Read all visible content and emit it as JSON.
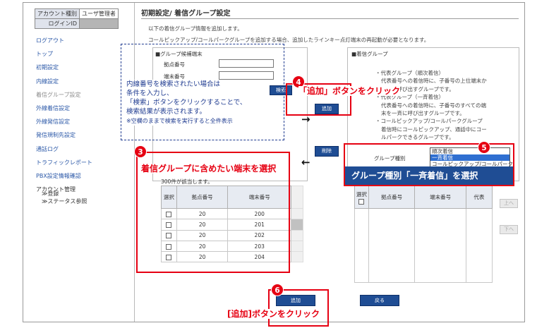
{
  "account": {
    "type_label": "アカウント種別",
    "type_value": "ユーザ管理者",
    "login_label": "ログインID"
  },
  "nav": {
    "logout": "ログアウト",
    "top": "トップ",
    "initial": "初期設定",
    "extension": "内線設定",
    "ring_group": "着信グループ設定",
    "external_in": "外線着信設定",
    "external_out": "外線発信設定",
    "call_rule": "発信規制先設定",
    "call_log": "通話ログ",
    "traffic": "トラフィックレポート",
    "pbx": "PBX設定情報確認",
    "account_mgmt": "アカウント管理",
    "register": "≫登録",
    "status": "≫ステータス参照"
  },
  "page": {
    "title": "初期設定/ 着信グループ設定",
    "desc1": "以下の着信グループ情報を追加します。",
    "desc2": "コールピックアップ/コールパークグループを追加する場合、追加したラインキー点灯端末の再起動が必要となります。"
  },
  "candidate": {
    "header": "■グループ候補端末",
    "base_label": "拠点番号",
    "ext_label": "端末番号",
    "search": "検索",
    "count": "300件が該当します。"
  },
  "buttons": {
    "add": "追加",
    "delete": "削除",
    "up": "上へ",
    "down": "下へ",
    "submit": "追加",
    "back": "戻る"
  },
  "group": {
    "header": "■着信グループ",
    "type_label": "グループ種別"
  },
  "desc_lines": [
    "・代表グループ（順次着信）",
    "代表番号への着信時に、子番号の上位端末か",
    "ら順に呼び出すグループです。",
    "・代表グループ（一斉着信）",
    "代表番号への着信時に、子番号のすべての端",
    "末を一斉に呼び出すグループです。",
    "・コールピックアップ/コールパークグループ",
    "着信時にコールピックアップ、通話中にコー",
    "ルパークできるグループです。"
  ],
  "dropdown": {
    "options": [
      "順次着信",
      "一斉着信",
      "コールピックアップ/コールパーク"
    ],
    "selected": "一斉着信"
  },
  "table": {
    "col_select": "選択",
    "col_base": "拠点番号",
    "col_ext": "端末番号",
    "col_rep": "代表",
    "rows": [
      [
        "20",
        "200"
      ],
      [
        "20",
        "201"
      ],
      [
        "20",
        "202"
      ],
      [
        "20",
        "203"
      ],
      [
        "20",
        "204"
      ]
    ]
  },
  "annotations": {
    "n3": "3",
    "n4": "4",
    "n5": "5",
    "n6": "6",
    "cap3": "着信グループに含めたい端末を選択",
    "cap4": "「追加」ボタンをクリック",
    "cap5": "グループ種別「一斉着信」を選択",
    "cap6": "[追加]ボタンをクリック",
    "note1": "内線番号を検索されたい場合は",
    "note2": "条件を入力し、",
    "note3": "「検索」ボタンをクリックすることで、",
    "note4": "検索結果が表示されます。",
    "note5": "※空欄のままで検索を実行すると全件表示"
  },
  "colors": {
    "accent": "#e60012",
    "button": "#1f4d94",
    "note": "#1f3b90",
    "link": "#2c59a8"
  }
}
